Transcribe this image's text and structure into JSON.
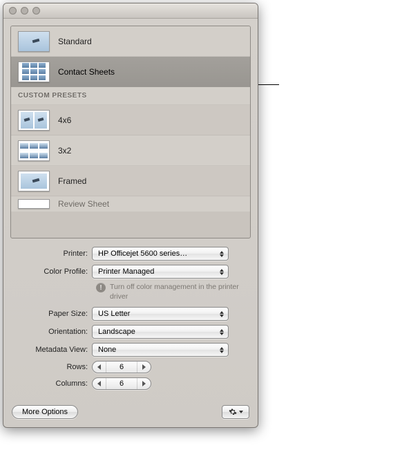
{
  "presets": {
    "standard_label": "Standard",
    "contact_sheets_label": "Contact Sheets",
    "custom_header": "CUSTOM PRESETS",
    "custom": [
      {
        "label": "4x6"
      },
      {
        "label": "3x2"
      },
      {
        "label": "Framed"
      },
      {
        "label": "Review Sheet"
      }
    ]
  },
  "form": {
    "printer_label": "Printer:",
    "printer_value": "HP Officejet 5600 series…",
    "color_profile_label": "Color Profile:",
    "color_profile_value": "Printer Managed",
    "color_hint": "Turn off color management in the printer driver",
    "paper_size_label": "Paper Size:",
    "paper_size_value": "US Letter",
    "orientation_label": "Orientation:",
    "orientation_value": "Landscape",
    "metadata_view_label": "Metadata View:",
    "metadata_view_value": "None",
    "rows_label": "Rows:",
    "rows_value": "6",
    "columns_label": "Columns:",
    "columns_value": "6"
  },
  "footer": {
    "more_options_label": "More Options"
  }
}
